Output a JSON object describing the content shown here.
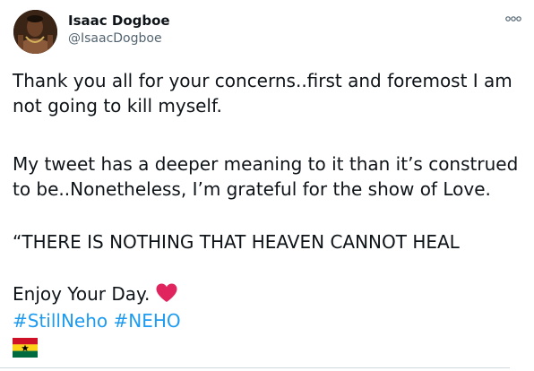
{
  "author": {
    "name": "Isaac Dogboe",
    "handle": "@IsaacDogboe"
  },
  "tweet": {
    "paragraph1_line1": "Thank you all for your concerns..first and foremost I am",
    "paragraph1_line2": "not going to kill myself.",
    "paragraph2_line1": "My tweet has a deeper meaning to it than it’s construed",
    "paragraph2_line2": "to be..Nonetheless, I’m grateful for the show of Love.",
    "paragraph3": "“THERE IS NOTHING THAT HEAVEN CANNOT HEAL",
    "paragraph4": "Enjoy Your Day.",
    "hashtags": [
      "#StillNeho",
      "#NEHO"
    ]
  },
  "icons": {
    "more": "more-options-icon",
    "heart": "red-heart-emoji",
    "flag": "ghana-flag-emoji",
    "avatar": "profile-photo"
  },
  "colors": {
    "text": "#0f1419",
    "secondary": "#536471",
    "link": "#1d9bf0",
    "heart": "#e0245e",
    "divider": "#cfd9de"
  }
}
